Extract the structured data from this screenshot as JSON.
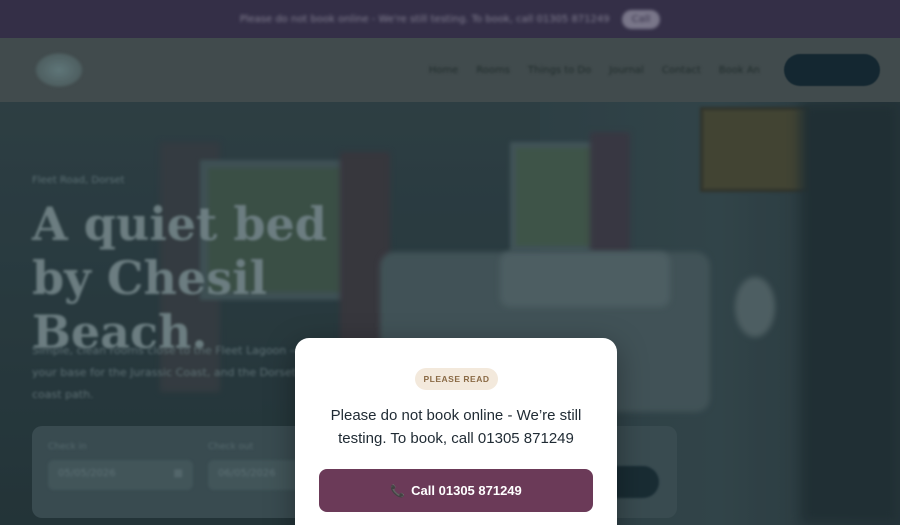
{
  "banner": {
    "text": "Please do not book online - We're still testing. To book, call 01305 871249",
    "call_label": "Call"
  },
  "nav": {
    "links": [
      "Home",
      "Rooms",
      "Things to Do",
      "Journal",
      "Contact",
      "Book An"
    ]
  },
  "hero": {
    "eyebrow": "Fleet Road, Dorset",
    "title": "A quiet bed by Chesil Beach.",
    "subtitle": "Simple, clean rooms close to the Fleet Lagoon — your base for the Jurassic Coast, and the Dorset coast path."
  },
  "booking": {
    "checkin_label": "Check in",
    "checkin_value": "05/05/2026",
    "checkout_label": "Check out",
    "checkout_value": "06/05/2026"
  },
  "modal": {
    "badge": "PLEASE READ",
    "message": "Please do not book online - We’re still testing. To book, call 01305 871249",
    "button_label": "Call 01305 871249",
    "button_icon": "phone-icon"
  },
  "colors": {
    "banner_bg": "#3b3450",
    "button_bg": "#6b3a58",
    "badge_bg": "#f3e9dc"
  }
}
